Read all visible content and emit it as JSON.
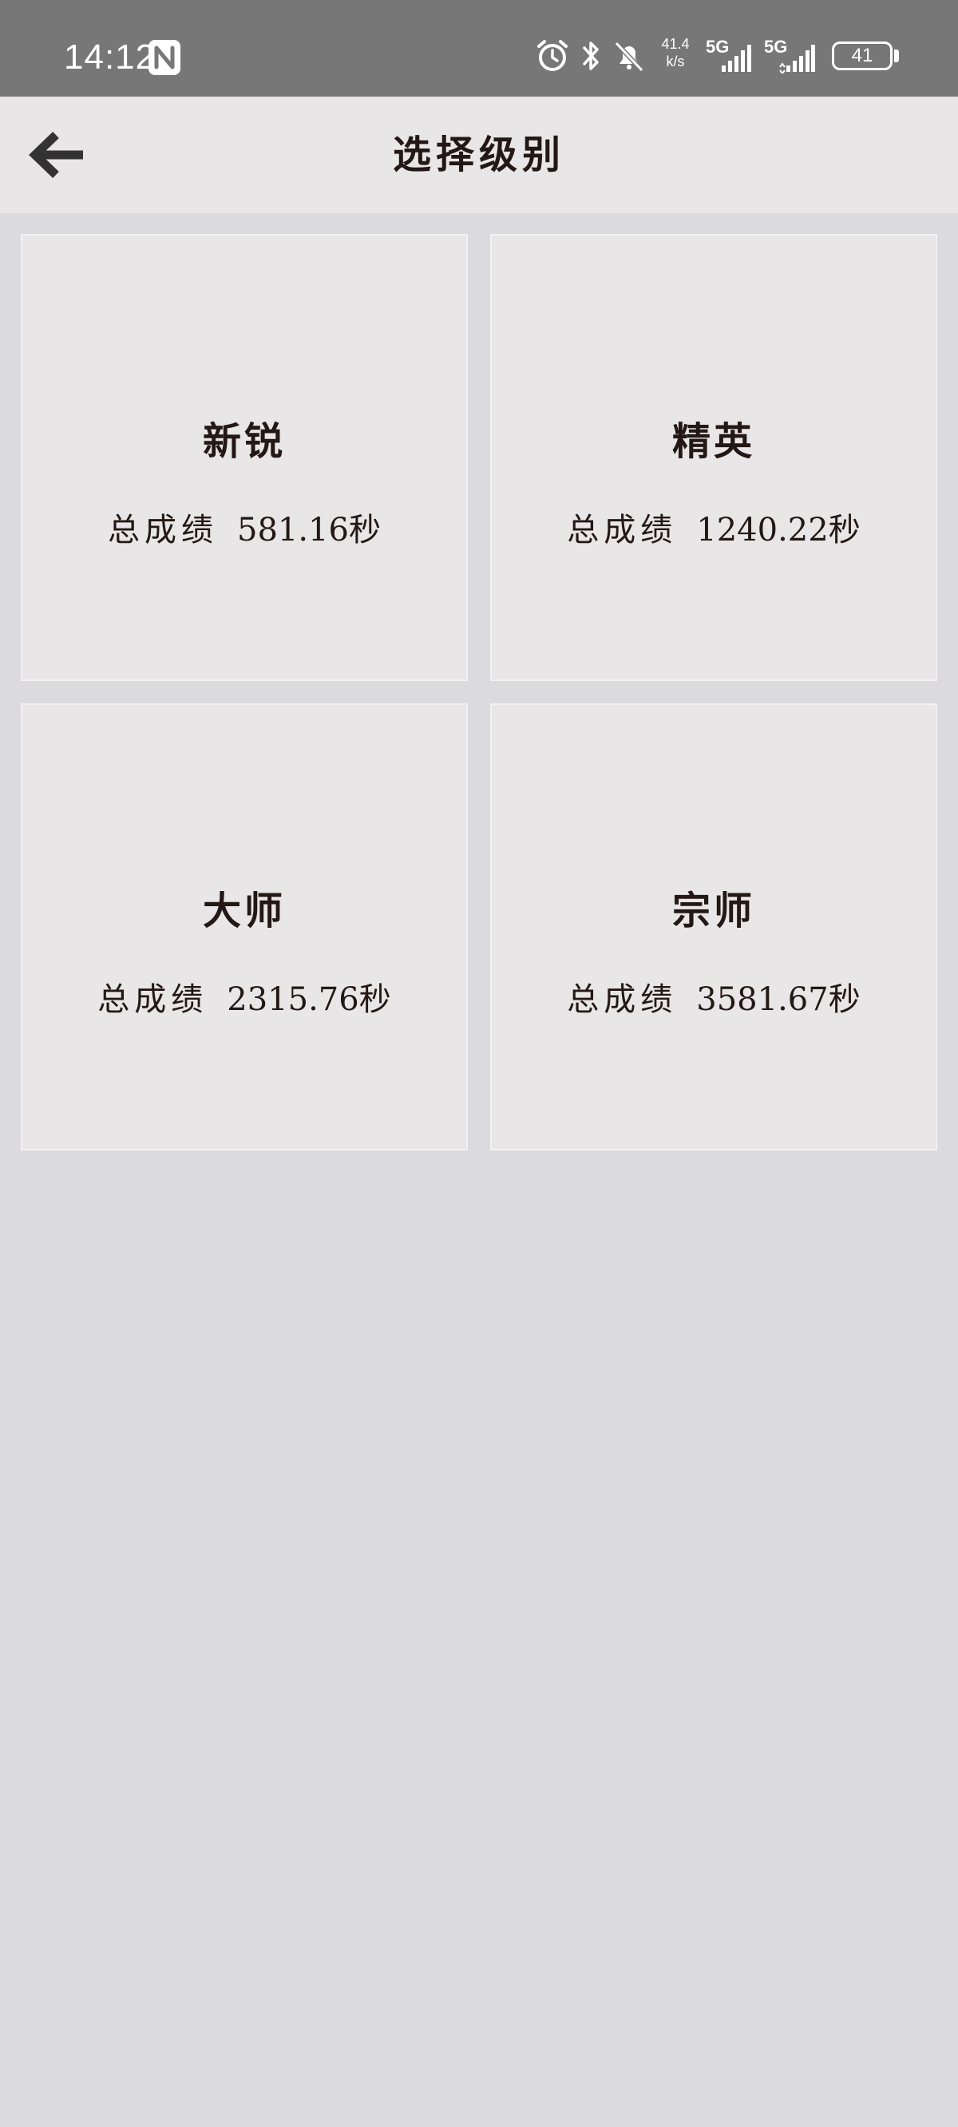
{
  "status_bar": {
    "time": "14:12",
    "net_speed_value": "41.4",
    "net_speed_unit": "k/s",
    "sim1_label": "5G",
    "sim2_label": "5G",
    "battery_level": "41"
  },
  "header": {
    "title": "选择级别",
    "back_icon": "arrow-left-icon"
  },
  "levels": [
    {
      "name": "新锐",
      "score_label": "总成绩",
      "score_value": "581.16秒"
    },
    {
      "name": "精英",
      "score_label": "总成绩",
      "score_value": "1240.22秒"
    },
    {
      "name": "大师",
      "score_label": "总成绩",
      "score_value": "2315.76秒"
    },
    {
      "name": "宗师",
      "score_label": "总成绩",
      "score_value": "3581.67秒"
    }
  ],
  "colors": {
    "status_bar_bg": "#777777",
    "app_bar_bg": "#e8e6e7",
    "page_bg": "#dbdbdd",
    "card_bg": "#e8e6e7",
    "text": "#231815"
  }
}
